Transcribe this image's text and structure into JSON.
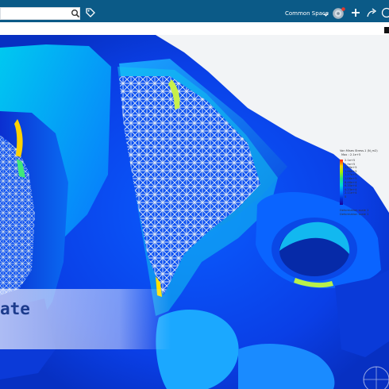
{
  "header": {
    "search": {
      "value": "",
      "placeholder": ""
    },
    "space_label": "Common Space",
    "icons": [
      "search-icon",
      "tag-icon",
      "chevron-down-icon",
      "compass-icon",
      "plus-icon",
      "share-icon",
      "help-icon"
    ]
  },
  "legend": {
    "title": "Von Mises Stress.1 (N_m2)",
    "max": "Max : 2.1e+5",
    "values": [
      "2.1e+5",
      "1.9e+5",
      "1.69e+5",
      "1.48e+5",
      "1.27e+5",
      "1.06e+5",
      "8.46e+4",
      "6.35e+4",
      "4.23e+4",
      "2.11e+4",
      "0"
    ],
    "footer_1": "Deformation scale 1",
    "footer_2": "Deformation scale 1",
    "colors": [
      "#ff1a00",
      "#ffd100",
      "#a8f000",
      "#26e07c",
      "#00d8d8",
      "#0078ff",
      "#0030d8",
      "#1a0096"
    ]
  },
  "banner": {
    "text": "ate"
  },
  "colors": {
    "topbar": "#0b5a87",
    "banner_text": "#1c3b8c",
    "background": "#f2f4f6"
  }
}
